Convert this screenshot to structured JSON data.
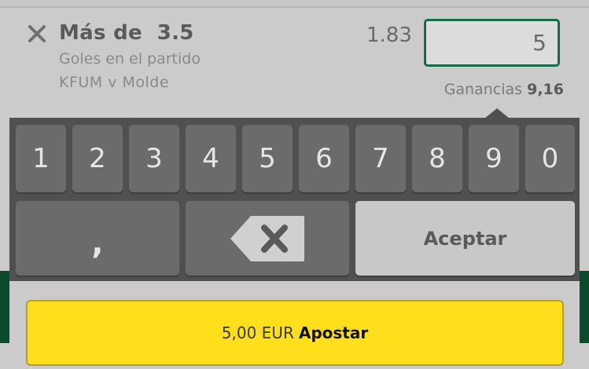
{
  "selection": {
    "title": "Más de  3.5",
    "market": "Goles en el partido",
    "event": "KFUM v Molde",
    "odds": "1.83",
    "stake_value": "5",
    "winnings_label": "Ganancias",
    "winnings_value": "9,16"
  },
  "keypad": {
    "digits": [
      "1",
      "2",
      "3",
      "4",
      "5",
      "6",
      "7",
      "8",
      "9",
      "0"
    ],
    "comma": ",",
    "accept": "Aceptar",
    "backspace_icon": "backspace-icon"
  },
  "place_bet": {
    "amount": "5,00 EUR",
    "label": "Apostar"
  },
  "colors": {
    "accent_green": "#146b45",
    "bet_button_yellow": "#ffdf1b",
    "keyboard_bg": "#505050"
  }
}
